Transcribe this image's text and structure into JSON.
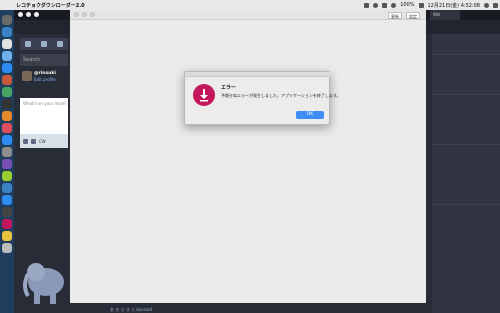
{
  "menubar": {
    "app_name": "レコチョクダウンローダー2.0",
    "battery": "100%",
    "clock": "12月21日(金) 4:52:08"
  },
  "background_app": {
    "tab_label": "Wel",
    "search_placeholder": "Search",
    "profile_handle": "@rinsuki",
    "edit_profile": "Edit profile",
    "composer_placeholder": "What's on your mind?",
    "privacy_label": "CW",
    "footer": "あ き ら き ら bonzoid"
  },
  "window": {
    "update_button": "更新",
    "settings_button": "設定"
  },
  "dialog": {
    "title": "エラー",
    "message": "予期せぬエラーが発生しました。アプリケーションを終了します。",
    "ok_label": "OK",
    "icon": "download-icon",
    "icon_color": "#c2185b"
  },
  "colors": {
    "accent": "#3d8ff7",
    "dock": "#1f3d5c"
  }
}
